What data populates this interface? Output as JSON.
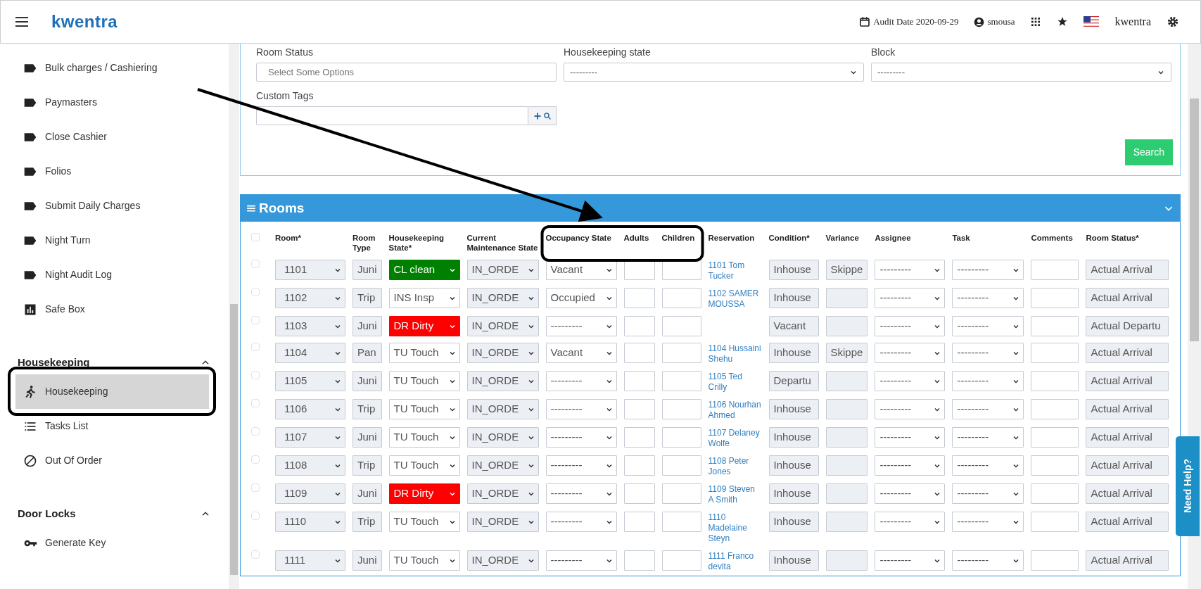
{
  "header": {
    "logo": "kwentra",
    "audit_date": "Audit Date 2020-09-29",
    "user": "smousa",
    "property": "kwentra"
  },
  "sidebar": {
    "items": [
      {
        "label": "Bulk charges / Cashiering",
        "kind": "tag",
        "selected": false
      },
      {
        "label": "Paymasters",
        "kind": "tag",
        "selected": false
      },
      {
        "label": "Close Cashier",
        "kind": "tag",
        "selected": false
      },
      {
        "label": "Folios",
        "kind": "tag",
        "selected": false
      },
      {
        "label": "Submit Daily Charges",
        "kind": "tag",
        "selected": false
      },
      {
        "label": "Night Turn",
        "kind": "tag",
        "selected": false
      },
      {
        "label": "Night Audit Log",
        "kind": "tag",
        "selected": false
      },
      {
        "label": "Safe Box",
        "kind": "chart",
        "selected": false
      }
    ],
    "sections": [
      {
        "title": "Housekeeping",
        "expanded": true,
        "items": [
          {
            "label": "Housekeeping",
            "kind": "walker",
            "selected": true
          },
          {
            "label": "Tasks List",
            "kind": "list",
            "selected": false
          },
          {
            "label": "Out Of Order",
            "kind": "blocked",
            "selected": false
          }
        ]
      },
      {
        "title": "Door Locks",
        "expanded": true,
        "items": [
          {
            "label": "Generate Key",
            "kind": "key",
            "selected": false
          }
        ]
      }
    ]
  },
  "filters": {
    "fields": [
      {
        "label": "Room Status",
        "kind": "multiselect",
        "placeholder": "Select Some Options"
      },
      {
        "label": "Housekeeping state",
        "kind": "select",
        "value": "---------"
      },
      {
        "label": "Block",
        "kind": "select",
        "value": "---------"
      },
      {
        "label": "Custom Tags",
        "kind": "tags"
      }
    ],
    "search_button": "Search"
  },
  "rooms": {
    "title": "Rooms",
    "select_all_checked": false,
    "columns": [
      "Room*",
      "Room Type",
      "Housekeeping State*",
      "Current Maintenance State",
      "Occupancy State",
      "Adults",
      "Children",
      "Reservation",
      "Condition*",
      "Variance",
      "Assignee",
      "Task",
      "Comments",
      "Room Status*"
    ],
    "rows": [
      {
        "checked": false,
        "room": "1101",
        "room_type": "Juni",
        "housekeeping_state": {
          "value": "CL clean",
          "color": "#008000"
        },
        "maintenance_state": "IN_ORDE",
        "occupancy_state": "Vacant",
        "reservation": "1101 Tom Tucker",
        "condition": "Inhouse",
        "variance": "Skippe",
        "assignee": "---------",
        "task": "---------",
        "room_status": "Actual Arrival"
      },
      {
        "checked": false,
        "room": "1102",
        "room_type": "Trip",
        "housekeeping_state": {
          "value": "INS Insp"
        },
        "maintenance_state": "IN_ORDE",
        "occupancy_state": "Occupied",
        "reservation": "1102 SAMER MOUSSA",
        "condition": "Inhouse",
        "assignee": "---------",
        "task": "---------",
        "room_status": "Actual Arrival"
      },
      {
        "checked": false,
        "room": "1103",
        "room_type": "Juni",
        "housekeeping_state": {
          "value": "DR Dirty",
          "color": "#ff0000"
        },
        "maintenance_state": "IN_ORDE",
        "occupancy_state": "---------",
        "condition": "Vacant",
        "assignee": "---------",
        "task": "---------",
        "room_status": "Actual Departu"
      },
      {
        "checked": false,
        "room": "1104",
        "room_type": "Pan",
        "housekeeping_state": {
          "value": "TU Touch"
        },
        "maintenance_state": "IN_ORDE",
        "occupancy_state": "Vacant",
        "reservation": "1104 Hussaini Shehu",
        "condition": "Inhouse",
        "variance": "Skippe",
        "assignee": "---------",
        "task": "---------",
        "room_status": "Actual Arrival"
      },
      {
        "checked": false,
        "room": "1105",
        "room_type": "Juni",
        "housekeeping_state": {
          "value": "TU Touch"
        },
        "maintenance_state": "IN_ORDE",
        "occupancy_state": "---------",
        "reservation": "1105 Ted Crilly",
        "condition": "Departu",
        "assignee": "---------",
        "task": "---------",
        "room_status": "Actual Arrival"
      },
      {
        "checked": false,
        "room": "1106",
        "room_type": "Trip",
        "housekeeping_state": {
          "value": "TU Touch"
        },
        "maintenance_state": "IN_ORDE",
        "occupancy_state": "---------",
        "reservation": "1106 Nourhan Ahmed",
        "condition": "Inhouse",
        "assignee": "---------",
        "task": "---------",
        "room_status": "Actual Arrival"
      },
      {
        "checked": false,
        "room": "1107",
        "room_type": "Juni",
        "housekeeping_state": {
          "value": "TU Touch"
        },
        "maintenance_state": "IN_ORDE",
        "occupancy_state": "---------",
        "reservation": "1107 Delaney Wolfe",
        "condition": "Inhouse",
        "assignee": "---------",
        "task": "---------",
        "room_status": "Actual Arrival"
      },
      {
        "checked": false,
        "room": "1108",
        "room_type": "Trip",
        "housekeeping_state": {
          "value": "TU Touch"
        },
        "maintenance_state": "IN_ORDE",
        "occupancy_state": "---------",
        "reservation": "1108 Peter Jones",
        "condition": "Inhouse",
        "assignee": "---------",
        "task": "---------",
        "room_status": "Actual Arrival"
      },
      {
        "checked": false,
        "room": "1109",
        "room_type": "Juni",
        "housekeeping_state": {
          "value": "DR Dirty",
          "color": "#ff0000"
        },
        "maintenance_state": "IN_ORDE",
        "occupancy_state": "---------",
        "reservation": "1109 Steven A Smith",
        "condition": "Inhouse",
        "assignee": "---------",
        "task": "---------",
        "room_status": "Actual Arrival"
      },
      {
        "checked": false,
        "room": "1110",
        "room_type": "Trip",
        "housekeeping_state": {
          "value": "TU Touch"
        },
        "maintenance_state": "IN_ORDE",
        "occupancy_state": "---------",
        "reservation": "1110 Madelaine Steyn",
        "condition": "Inhouse",
        "assignee": "---------",
        "task": "---------",
        "room_status": "Actual Arrival"
      },
      {
        "checked": false,
        "room": "1111",
        "room_type": "Juni",
        "housekeeping_state": {
          "value": "TU Touch"
        },
        "maintenance_state": "IN_ORDE",
        "occupancy_state": "---------",
        "reservation": "1111 Franco devita",
        "condition": "Inhouse",
        "assignee": "---------",
        "task": "---------",
        "room_status": "Actual Arrival"
      }
    ]
  },
  "help_tab": "Need Help?"
}
